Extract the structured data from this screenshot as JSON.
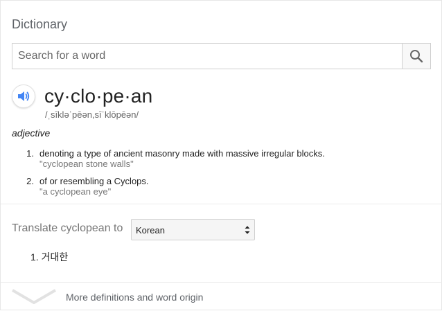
{
  "header": {
    "title": "Dictionary"
  },
  "search": {
    "placeholder": "Search for a word",
    "value": ""
  },
  "entry": {
    "word": "cy·clo·pe·an",
    "phonetic": "/ˌsīkləˈpēən,sīˈklōpēən/",
    "part_of_speech": "adjective",
    "definitions": [
      {
        "num": "1.",
        "text": "denoting a type of ancient masonry made with massive irregular blocks.",
        "example": "\"cyclopean stone walls\""
      },
      {
        "num": "2.",
        "text": "of or resembling a Cyclops.",
        "example": "\"a cyclopean eye\""
      }
    ]
  },
  "translate": {
    "label": "Translate cyclopean to",
    "language": "Korean",
    "results": [
      {
        "num": "1.",
        "text": "거대한"
      }
    ]
  },
  "footer": {
    "more_label": "More definitions and word origin"
  },
  "icons": {
    "search": "search-icon",
    "speaker": "speaker-icon",
    "dropdown": "dropdown-arrows-icon",
    "expand": "chevron-down-icon"
  },
  "colors": {
    "accent": "#4285f4",
    "muted": "#5f6368",
    "example": "#777777"
  }
}
